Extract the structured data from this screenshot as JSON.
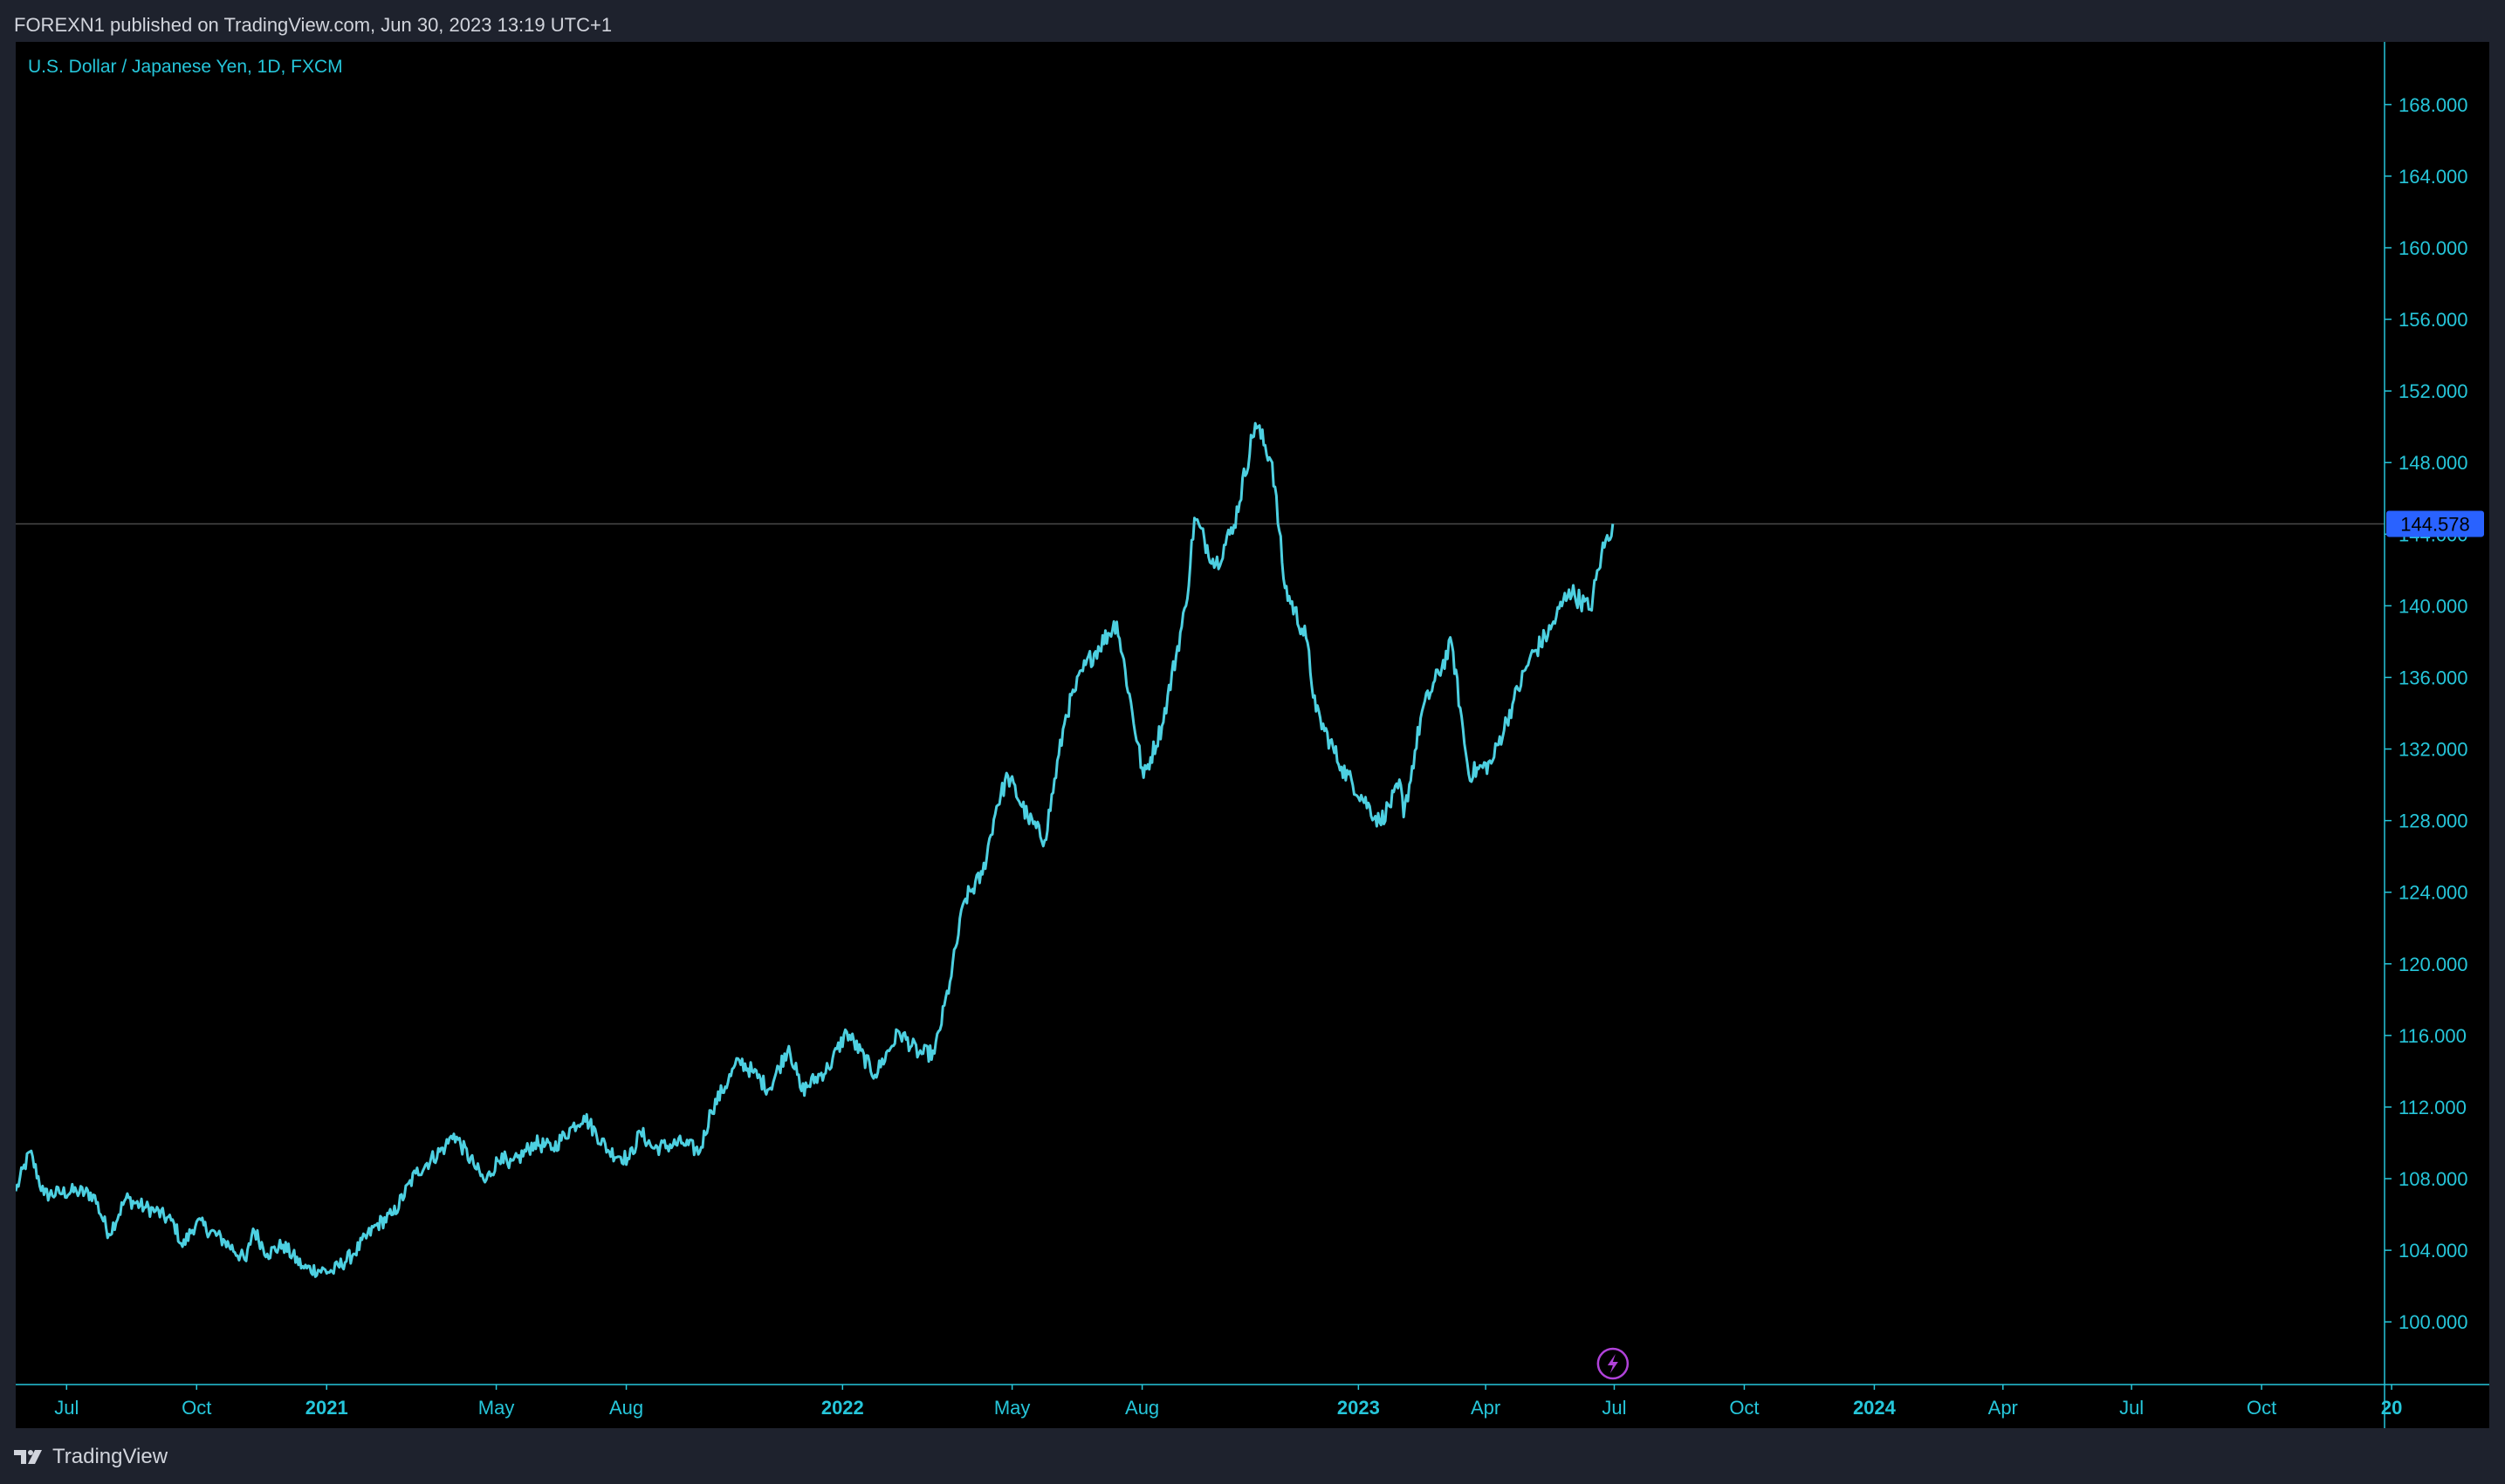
{
  "header": {
    "publish_text": "FOREXN1 published on TradingView.com, Jun 30, 2023 13:19 UTC+1"
  },
  "footer": {
    "brand": "TradingView",
    "logo_icon": "tradingview-logo-icon"
  },
  "lightning_icon": "lightning-icon",
  "colors": {
    "page_bg": "#1e222d",
    "chart_bg": "#000000",
    "line": "#4dd0e1",
    "axis_text": "#26c6da",
    "price_tag_bg": "#2962ff",
    "price_tag_text": "#000000",
    "event_marker": "#b042d9"
  },
  "chart_data": {
    "type": "line",
    "title": "U.S. Dollar / Japanese Yen, 1D, FXCM",
    "last_price_label": "144.578",
    "last_price": 144.578,
    "ylim": [
      96.5,
      171.5
    ],
    "y_ticks": [
      {
        "value": 100,
        "label": "100.000"
      },
      {
        "value": 104,
        "label": "104.000"
      },
      {
        "value": 108,
        "label": "108.000"
      },
      {
        "value": 112,
        "label": "112.000"
      },
      {
        "value": 116,
        "label": "116.000"
      },
      {
        "value": 120,
        "label": "120.000"
      },
      {
        "value": 124,
        "label": "124.000"
      },
      {
        "value": 128,
        "label": "128.000"
      },
      {
        "value": 132,
        "label": "132.000"
      },
      {
        "value": 136,
        "label": "136.000"
      },
      {
        "value": 140,
        "label": "140.000"
      },
      {
        "value": 144,
        "label": "144.000"
      },
      {
        "value": 148,
        "label": "148.000"
      },
      {
        "value": 152,
        "label": "152.000"
      },
      {
        "value": 156,
        "label": "156.000"
      },
      {
        "value": 160,
        "label": "160.000"
      },
      {
        "value": 164,
        "label": "164.000"
      },
      {
        "value": 168,
        "label": "168.000"
      }
    ],
    "xlim": [
      "2020-05-26",
      "2024-12-27"
    ],
    "x_ticks": [
      {
        "date": "2020-07-01",
        "label": "Jul",
        "bold": false
      },
      {
        "date": "2020-10-01",
        "label": "Oct",
        "bold": false
      },
      {
        "date": "2021-01-01",
        "label": "2021",
        "bold": true
      },
      {
        "date": "2021-05-01",
        "label": "May",
        "bold": false
      },
      {
        "date": "2021-08-01",
        "label": "Aug",
        "bold": false
      },
      {
        "date": "2022-01-01",
        "label": "2022",
        "bold": true
      },
      {
        "date": "2022-05-01",
        "label": "May",
        "bold": false
      },
      {
        "date": "2022-08-01",
        "label": "Aug",
        "bold": false
      },
      {
        "date": "2023-01-01",
        "label": "2023",
        "bold": true
      },
      {
        "date": "2023-04-01",
        "label": "Apr",
        "bold": false
      },
      {
        "date": "2023-07-01",
        "label": "Jul",
        "bold": false
      },
      {
        "date": "2023-10-01",
        "label": "Oct",
        "bold": false
      },
      {
        "date": "2024-01-01",
        "label": "2024",
        "bold": true
      },
      {
        "date": "2024-04-01",
        "label": "Apr",
        "bold": false
      },
      {
        "date": "2024-07-01",
        "label": "Jul",
        "bold": false
      },
      {
        "date": "2024-10-01",
        "label": "Oct",
        "bold": false
      },
      {
        "date": "2025-01-01",
        "label": "20",
        "bold": true
      }
    ],
    "series": [
      {
        "points": [
          [
            "2020-05-26",
            107.3
          ],
          [
            "2020-06-05",
            109.5
          ],
          [
            "2020-06-15",
            107.1
          ],
          [
            "2020-06-26",
            107.2
          ],
          [
            "2020-07-08",
            107.3
          ],
          [
            "2020-07-20",
            107.1
          ],
          [
            "2020-07-31",
            104.9
          ],
          [
            "2020-08-12",
            106.9
          ],
          [
            "2020-08-25",
            106.4
          ],
          [
            "2020-09-02",
            106.2
          ],
          [
            "2020-09-15",
            105.5
          ],
          [
            "2020-09-21",
            104.2
          ],
          [
            "2020-10-01",
            105.6
          ],
          [
            "2020-10-21",
            104.5
          ],
          [
            "2020-11-05",
            103.4
          ],
          [
            "2020-11-10",
            105.2
          ],
          [
            "2020-11-20",
            103.8
          ],
          [
            "2020-12-01",
            104.3
          ],
          [
            "2020-12-16",
            103.0
          ],
          [
            "2021-01-05",
            102.8
          ],
          [
            "2021-01-20",
            103.8
          ],
          [
            "2021-02-05",
            105.4
          ],
          [
            "2021-02-17",
            106.0
          ],
          [
            "2021-03-05",
            108.3
          ],
          [
            "2021-03-26",
            109.8
          ],
          [
            "2021-04-01",
            110.5
          ],
          [
            "2021-04-15",
            108.8
          ],
          [
            "2021-04-23",
            107.8
          ],
          [
            "2021-05-05",
            109.4
          ],
          [
            "2021-05-10",
            108.6
          ],
          [
            "2021-05-28",
            110.0
          ],
          [
            "2021-06-10",
            109.7
          ],
          [
            "2021-06-24",
            110.9
          ],
          [
            "2021-07-02",
            111.5
          ],
          [
            "2021-07-20",
            109.5
          ],
          [
            "2021-08-03",
            109.1
          ],
          [
            "2021-08-11",
            110.6
          ],
          [
            "2021-08-20",
            109.7
          ],
          [
            "2021-09-10",
            110.0
          ],
          [
            "2021-09-22",
            109.5
          ],
          [
            "2021-09-30",
            111.8
          ],
          [
            "2021-10-20",
            114.6
          ],
          [
            "2021-10-29",
            114.0
          ],
          [
            "2021-11-10",
            113.0
          ],
          [
            "2021-11-24",
            115.4
          ],
          [
            "2021-12-03",
            112.9
          ],
          [
            "2021-12-22",
            114.2
          ],
          [
            "2022-01-04",
            116.2
          ],
          [
            "2022-01-24",
            113.8
          ],
          [
            "2022-02-10",
            116.2
          ],
          [
            "2022-02-24",
            115.0
          ],
          [
            "2022-03-07",
            115.0
          ],
          [
            "2022-03-18",
            119.0
          ],
          [
            "2022-03-28",
            123.5
          ],
          [
            "2022-04-10",
            125.0
          ],
          [
            "2022-04-20",
            128.8
          ],
          [
            "2022-04-28",
            130.5
          ],
          [
            "2022-05-12",
            128.2
          ],
          [
            "2022-05-24",
            126.9
          ],
          [
            "2022-06-08",
            133.9
          ],
          [
            "2022-06-14",
            135.2
          ],
          [
            "2022-06-22",
            136.7
          ],
          [
            "2022-07-14",
            139.1
          ],
          [
            "2022-08-02",
            130.4
          ],
          [
            "2022-08-15",
            133.3
          ],
          [
            "2022-09-01",
            140.0
          ],
          [
            "2022-09-07",
            144.9
          ],
          [
            "2022-09-22",
            142.3
          ],
          [
            "2022-10-05",
            144.5
          ],
          [
            "2022-10-20",
            150.2
          ],
          [
            "2022-11-01",
            148.0
          ],
          [
            "2022-11-10",
            141.0
          ],
          [
            "2022-11-25",
            138.2
          ],
          [
            "2022-12-02",
            134.1
          ],
          [
            "2022-12-20",
            131.0
          ],
          [
            "2023-01-16",
            127.9
          ],
          [
            "2023-01-31",
            130.0
          ],
          [
            "2023-02-02",
            128.2
          ],
          [
            "2023-02-15",
            134.1
          ],
          [
            "2023-03-08",
            137.9
          ],
          [
            "2023-03-20",
            130.6
          ],
          [
            "2023-04-05",
            131.2
          ],
          [
            "2023-04-20",
            134.5
          ],
          [
            "2023-05-02",
            137.0
          ],
          [
            "2023-05-17",
            138.7
          ],
          [
            "2023-05-30",
            140.9
          ],
          [
            "2023-06-14",
            139.8
          ],
          [
            "2023-06-22",
            142.9
          ],
          [
            "2023-06-30",
            144.578
          ]
        ]
      }
    ]
  }
}
